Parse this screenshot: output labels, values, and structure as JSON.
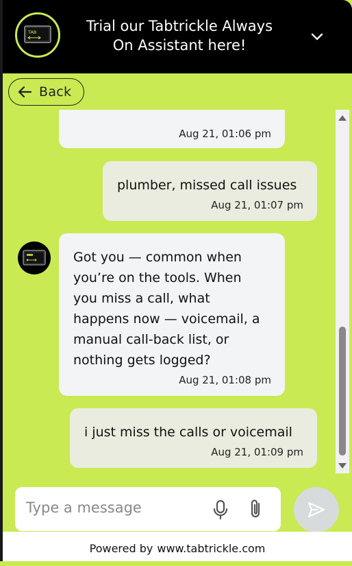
{
  "header": {
    "title_line1": "Trial our Tabtrickle Always",
    "title_line2": "On Assistant here!",
    "logo_text": "TAB",
    "collapse_icon": "chevron-down-icon"
  },
  "nav": {
    "back_label": "Back"
  },
  "messages": [
    {
      "role": "bot",
      "text": "",
      "time": "Aug 21, 01:06 pm"
    },
    {
      "role": "user",
      "text": "plumber, missed call issues",
      "time": "Aug 21, 01:07 pm"
    },
    {
      "role": "bot",
      "lines": [
        "Got you — common when",
        "you’re on the tools. When",
        "you miss a call, what",
        "happens now — voicemail, a",
        "manual call-back list, or",
        "nothing gets logged?"
      ],
      "time": "Aug 21, 01:08 pm"
    },
    {
      "role": "user",
      "text": "i just miss the calls or voicemail",
      "time": "Aug 21, 01:09 pm"
    }
  ],
  "composer": {
    "placeholder": "Type a message"
  },
  "footer": {
    "powered_by": "Powered by",
    "link": "www.tabtrickle.com"
  },
  "colors": {
    "accent": "#c9ea52",
    "header_bg": "#000000",
    "bot_bubble": "#f3f4f5",
    "user_bubble": "#e9ecdf"
  }
}
